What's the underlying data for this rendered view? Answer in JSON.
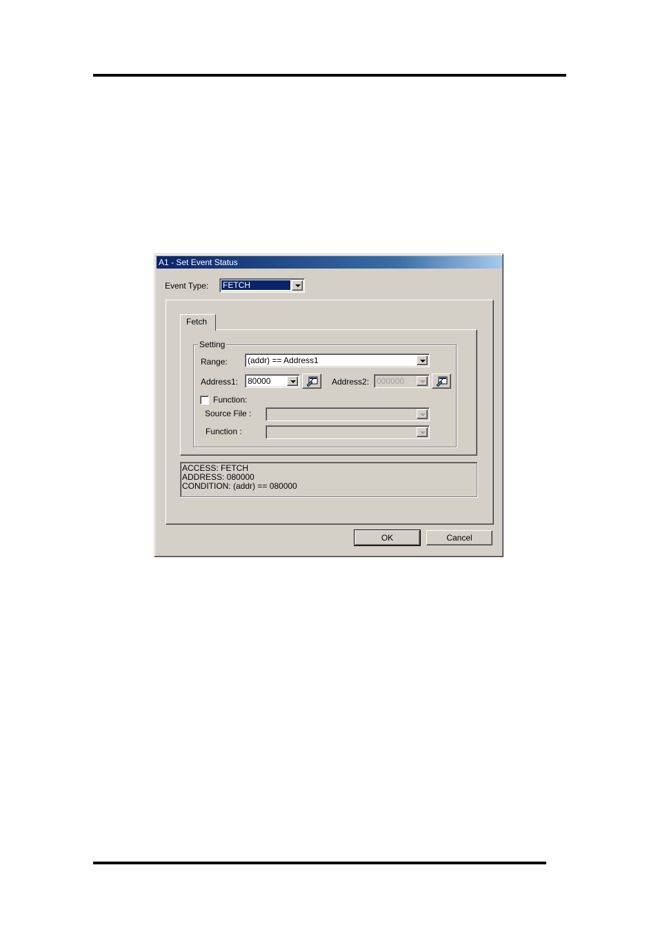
{
  "window": {
    "title": "A1 - Set Event Status"
  },
  "event_type": {
    "label": "Event Type:",
    "value": "FETCH"
  },
  "tabs": [
    {
      "label": "Fetch"
    }
  ],
  "setting": {
    "group_label": "Setting",
    "range": {
      "label": "Range:",
      "value": "(addr) == Address1"
    },
    "address1": {
      "label": "Address1:",
      "value": "80000"
    },
    "address2": {
      "label": "Address2:",
      "value": "000000"
    },
    "function_check": {
      "label": "Function:",
      "checked": false
    },
    "source_file": {
      "label": "Source File :",
      "value": ""
    },
    "function": {
      "label": "Function :",
      "value": ""
    }
  },
  "status": {
    "lines": [
      "ACCESS: FETCH",
      "ADDRESS: 080000",
      "CONDITION: (addr) == 080000"
    ]
  },
  "buttons": {
    "ok": "OK",
    "cancel": "Cancel"
  },
  "colors": {
    "face": "#d4d0c8",
    "title_start": "#0a246a",
    "title_end": "#a6caf0",
    "selection": "#0a246a"
  },
  "icons": {
    "browse_button": "symbol-browse-icon"
  }
}
